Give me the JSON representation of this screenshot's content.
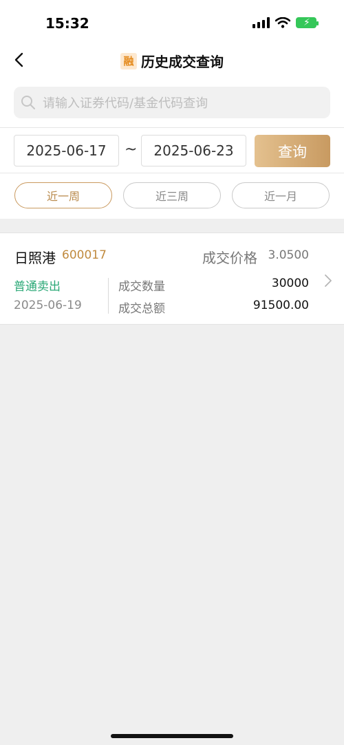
{
  "status_bar": {
    "time": "15:32"
  },
  "nav": {
    "title": "历史成交查询",
    "badge": "融"
  },
  "search": {
    "placeholder": "请输入证券代码/基金代码查询"
  },
  "date_range": {
    "start": "2025-06-17",
    "separator": "~",
    "end": "2025-06-23"
  },
  "query_button": {
    "label": "查询"
  },
  "quick_ranges": [
    {
      "label": "近一周",
      "active": true
    },
    {
      "label": "近三周",
      "active": false
    },
    {
      "label": "近一月",
      "active": false
    }
  ],
  "records": [
    {
      "name": "日照港",
      "code": "600017",
      "price_label": "成交价格",
      "price": "3.0500",
      "trade_type": "普通卖出",
      "date": "2025-06-19",
      "qty_label": "成交数量",
      "qty": "30000",
      "amount_label": "成交总额",
      "amount": "91500.00"
    }
  ],
  "colors": {
    "accent_gold": "#c9995e",
    "sell_green": "#2aa876",
    "code_gold": "#c08a3e",
    "battery_green": "#35c759"
  },
  "icons": [
    "back-arrow-icon",
    "search-icon",
    "chevron-right-icon",
    "signal-icon",
    "wifi-icon",
    "battery-icon"
  ]
}
